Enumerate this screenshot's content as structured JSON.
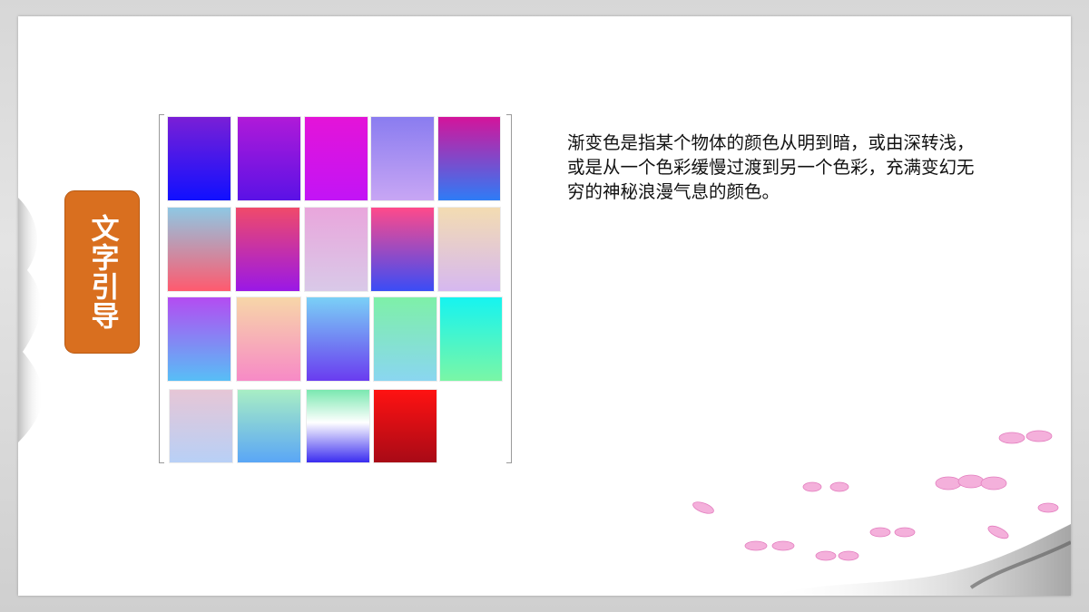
{
  "slide": {
    "title": "文字引导",
    "description": "渐变色是指某个物体的颜色从明到暗，或由深转浅，或是从一个色彩缓慢过渡到另一个色彩，充满变幻无穷的神秘浪漫气息的颜色。"
  },
  "palette": {
    "rows": [
      [
        {
          "from": "#7a1fd6",
          "to": "#1010ff"
        },
        {
          "from": "#b01ad8",
          "to": "#5a12e6"
        },
        {
          "from": "#e414d8",
          "to": "#c214f6"
        },
        {
          "from": "#8a7cf0",
          "to": "#c8a6f4"
        },
        {
          "from": "#d4149a",
          "to": "#2e7cf6"
        }
      ],
      [
        {
          "from": "#8ec8e4",
          "to": "#ff5a6e"
        },
        {
          "from": "#f04a6a",
          "to": "#9a18e6"
        },
        {
          "from": "#e9a6dc",
          "to": "#d9c9e8"
        },
        {
          "from": "#ff4a8a",
          "to": "#3a4cf6"
        },
        {
          "from": "#f3dcb2",
          "to": "#d6b8f0"
        }
      ],
      [
        {
          "from": "#b44cf2",
          "to": "#58bef6"
        },
        {
          "from": "#f7d6a8",
          "to": "#f78ac6"
        },
        {
          "from": "#7ad0f6",
          "to": "#6a3cf0"
        },
        {
          "from": "#7ef0a8",
          "to": "#8ad6f0"
        },
        {
          "from": "#16f4f0",
          "to": "#7af6a6"
        }
      ],
      [
        {
          "from": "#e6c6d6",
          "to": "#b8d0f6"
        },
        {
          "from": "#a8eec4",
          "to": "#5aa6f6"
        },
        {
          "from": "#7ae8b0",
          "to": "#3a2cf0"
        },
        {
          "from": "#ff1212",
          "to": "#a80a16"
        }
      ]
    ]
  }
}
